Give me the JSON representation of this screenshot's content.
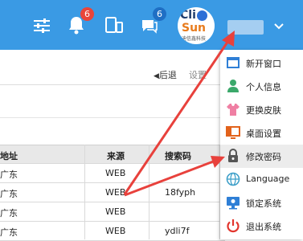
{
  "header": {
    "notification_count": "6",
    "message_count": "6",
    "logo": {
      "line1": "Cli",
      "line2": "Sun",
      "line3": "迪信鑫科技"
    },
    "dropdown_caret": "⌄"
  },
  "toolbar": {
    "back_label": "后退",
    "settings_label": "设置"
  },
  "table": {
    "columns": [
      "地址",
      "来源",
      "搜索码"
    ],
    "rows": [
      {
        "address": "广东",
        "source": "WEB",
        "code": ""
      },
      {
        "address": "广东",
        "source": "WEB",
        "code": "18fyph"
      },
      {
        "address": "广东",
        "source": "WEB",
        "code": ""
      },
      {
        "address": "广东",
        "source": "WEB",
        "code": "ydli7f"
      }
    ]
  },
  "user_menu": {
    "items": [
      {
        "label": "新开窗口",
        "icon": "new-window-icon"
      },
      {
        "label": "个人信息",
        "icon": "person-icon"
      },
      {
        "label": "更换皮肤",
        "icon": "tshirt-icon"
      },
      {
        "label": "桌面设置",
        "icon": "desktop-icon"
      },
      {
        "label": "修改密码",
        "icon": "lock-icon"
      },
      {
        "label": "Language",
        "icon": "globe-icon"
      },
      {
        "label": "锁定系统",
        "icon": "monitor-lock-icon"
      },
      {
        "label": "退出系统",
        "icon": "power-icon"
      }
    ]
  },
  "colors": {
    "header_bg": "#3a9ae4",
    "badge_red": "#e9453a",
    "annotation_red": "#e8413c"
  }
}
